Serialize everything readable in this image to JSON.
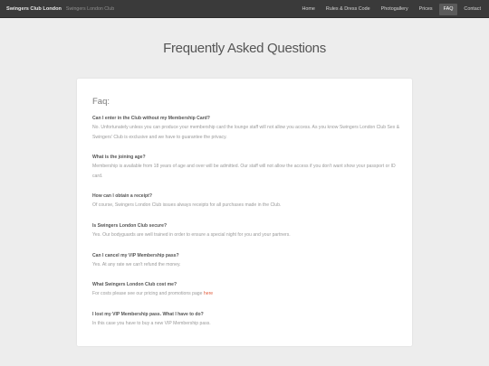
{
  "navbar": {
    "brand": "Swingers Club London",
    "tagline": "Swingers London Club",
    "items": [
      {
        "label": "Home",
        "active": false
      },
      {
        "label": "Rules & Dress Code",
        "active": false
      },
      {
        "label": "Photogallery",
        "active": false
      },
      {
        "label": "Prices",
        "active": false
      },
      {
        "label": "FAQ",
        "active": true
      },
      {
        "label": "Contact",
        "active": false
      }
    ]
  },
  "page": {
    "title": "Frequently Asked Questions"
  },
  "faq": {
    "heading": "Faq:",
    "items": [
      {
        "question": "Can I enter in the Club without my Membership Card?",
        "answer": "No. Unfortunately unless you can produce your membership card the lounge staff will not allow you access. As you know Swingers London Club Sex & Swingers' Club is exclusive and we have to guarantee the privacy."
      },
      {
        "question": "What is the joining age?",
        "answer": "Membership is available from 18 years of age and over will be admitted. Our staff will not allow the access if you don't want show your passport or ID card."
      },
      {
        "question": "How can I obtain a receipt?",
        "answer": "Of course, Swingers London Club issues always receipts for all purchases made in the Club."
      },
      {
        "question": "Is Swingers London Club secure?",
        "answer": "Yes. Our bodyguards are well trained in order to ensure a special night for you and your partners."
      },
      {
        "question": "Can I cancel my VIP Membership pass?",
        "answer": "Yes. At any rate we can't refund the money."
      },
      {
        "question": "What Swingers London Club cost me?",
        "answer": "For costs please see our pricing and promotions page",
        "link": "here"
      },
      {
        "question": "I lost my VIP Membership pass. What I have to do?",
        "answer": "In this case you have to buy a new VIP Membership pass."
      }
    ]
  }
}
